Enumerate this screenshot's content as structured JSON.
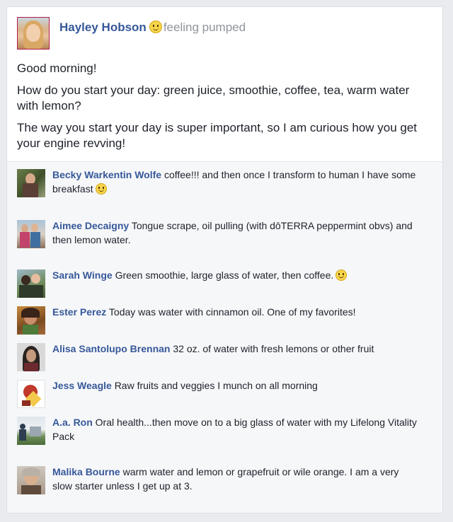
{
  "post": {
    "author": "Hayley Hobson",
    "feeling": "feeling pumped",
    "feeling_icon": "smiley-icon",
    "paragraphs": [
      "Good morning!",
      "How do you start your day: green juice, smoothie, coffee, tea, warm water with lemon?",
      "The way you start your day is super important, so I am curious how you get your engine revving!"
    ]
  },
  "comments": [
    {
      "name": "Becky Warkentin Wolfe",
      "text": "coffee!!! and then once I transform to human I have some breakfast",
      "emoji": "smiley-icon"
    },
    {
      "name": "Aimee Decaigny",
      "text": "Tongue scrape, oil pulling (with dōTERRA peppermint obvs) and then lemon water."
    },
    {
      "name": "Sarah Winge",
      "text": "Green smoothie, large glass of water, then coffee.",
      "emoji": "smiley-icon"
    },
    {
      "name": "Ester Perez",
      "text": "Today was water with cinnamon oil. One of my favorites!"
    },
    {
      "name": "Alisa Santolupo Brennan",
      "text": "32 oz. of water with fresh lemons or other fruit"
    },
    {
      "name": "Jess Weagle",
      "text": "Raw fruits and veggies I munch on all morning"
    },
    {
      "name": "A.a. Ron",
      "text": "Oral health...then move on to a big glass of water with my Lifelong Vitality Pack"
    },
    {
      "name": "Malika Bourne",
      "text": "warm water and lemon or grapefruit or wile orange. I am a very slow starter unless I get up at 3."
    }
  ],
  "colors": {
    "link_blue": "#365899",
    "muted_gray": "#90949c",
    "comments_bg": "#f6f7f9"
  }
}
